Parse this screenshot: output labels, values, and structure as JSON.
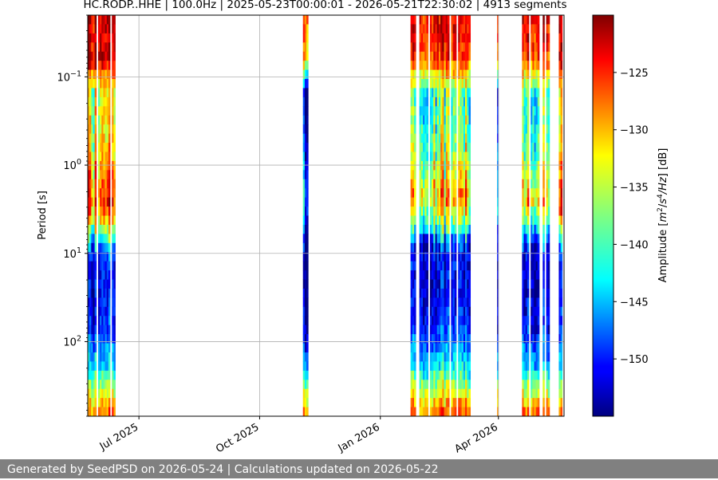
{
  "chart_data": {
    "type": "heatmap",
    "title": "HC.RODP..HHE | 100.0Hz | 2025-05-23T00:00:01 - 2026-05-21T22:30:02 | 4913 segments",
    "ylabel": "Period [s]",
    "xlabel": "",
    "y_scale": "log",
    "y_inverted": true,
    "ylim": [
      0.02,
      700
    ],
    "xlim": [
      "2025-05-23",
      "2026-05-21"
    ],
    "grid": true,
    "x_ticks": [
      {
        "date": "2025-07-01",
        "label": "Jul 2025"
      },
      {
        "date": "2025-10-01",
        "label": "Oct 2025"
      },
      {
        "date": "2026-01-01",
        "label": "Jan 2026"
      },
      {
        "date": "2026-04-01",
        "label": "Apr 2026"
      }
    ],
    "y_ticks": [
      {
        "value": 0.1,
        "base": "10",
        "exp": "−1"
      },
      {
        "value": 1,
        "base": "10",
        "exp": "0"
      },
      {
        "value": 10,
        "base": "10",
        "exp": "1"
      },
      {
        "value": 100,
        "base": "10",
        "exp": "2"
      }
    ],
    "colorbar": {
      "label": "Amplitude [m²/s⁴/Hz] [dB]",
      "label_parts": [
        "Amplitude [",
        "m",
        "2",
        "/",
        "s",
        "4",
        "/",
        "Hz",
        "] [dB]"
      ],
      "colormap": "jet",
      "range": [
        -155,
        -120
      ],
      "ticks": [
        -125,
        -130,
        -135,
        -140,
        -145,
        -150
      ],
      "tick_labels": [
        "−125",
        "−130",
        "−135",
        "−140",
        "−145",
        "−150"
      ]
    },
    "data_periods": [
      {
        "start": "2025-05-23",
        "end": "2025-06-13",
        "profile": "A"
      },
      {
        "start": "2025-11-03",
        "end": "2025-11-07",
        "profile": "narrow"
      },
      {
        "start": "2026-01-24",
        "end": "2026-03-12",
        "profile": "B"
      },
      {
        "start": "2026-03-31",
        "end": "2026-04-01",
        "profile": "narrow"
      },
      {
        "start": "2026-04-19",
        "end": "2026-05-10",
        "profile": "C"
      },
      {
        "start": "2026-05-17",
        "end": "2026-05-21",
        "profile": "A"
      }
    ]
  },
  "footer": {
    "text": "Generated by SeedPSD on 2026-05-24 | Calculations updated on 2026-05-22"
  }
}
